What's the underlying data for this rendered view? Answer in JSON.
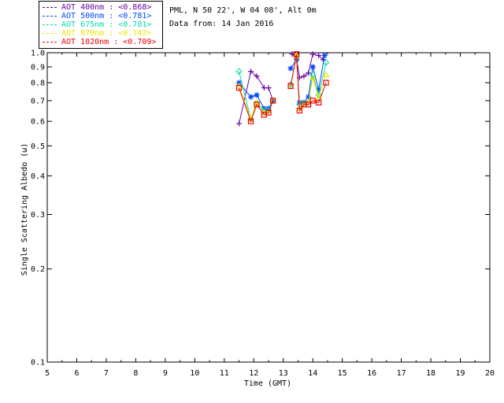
{
  "header": {
    "site_line": "PML, N 50 22', W 04 08', Alt 0m",
    "date_line": "Data from: 14 Jan 2016"
  },
  "legend": [
    {
      "label": "AOT  400nm : <0.868>",
      "color": "#6a00a8"
    },
    {
      "label": "AOT  500nm : <0.781>",
      "color": "#0044ff"
    },
    {
      "label": "AOT  675nm : <0.781>",
      "color": "#00d8b0"
    },
    {
      "label": "AOT  870nm : <0.742>",
      "color": "#e8e800"
    },
    {
      "label": "AOT 1020nm : <0.709>",
      "color": "#ee0000"
    }
  ],
  "chart_data": {
    "type": "scatter",
    "xlabel": "Time (GMT)",
    "ylabel": "Single Scattering Albedo (ω)",
    "xlim": [
      5,
      20
    ],
    "ylim": [
      0.1,
      1.0
    ],
    "yscale": "log",
    "xticks": [
      5,
      6,
      7,
      8,
      9,
      10,
      11,
      12,
      13,
      14,
      15,
      16,
      17,
      18,
      19,
      20
    ],
    "yticks": [
      0.1,
      0.2,
      0.3,
      0.4,
      0.5,
      0.6,
      0.7,
      0.8,
      0.9,
      1.0
    ],
    "ytick_labels": [
      "0.1",
      "0.2",
      "0.3",
      "0.4",
      "0.5",
      "0.6",
      "0.7",
      "0.8",
      "0.9",
      "1.0"
    ],
    "grid": false,
    "series": [
      {
        "name": "AOT  400nm",
        "color": "#6a00a8",
        "marker": "plus",
        "x": [
          11.5,
          11.9,
          12.1,
          12.35,
          12.5,
          12.65,
          13.3,
          13.45,
          13.55,
          13.7,
          13.85,
          14.0,
          14.2,
          14.35
        ],
        "y": [
          0.59,
          0.87,
          0.84,
          0.77,
          0.77,
          0.7,
          0.99,
          0.96,
          0.83,
          0.84,
          0.86,
          0.99,
          0.98,
          0.95
        ]
      },
      {
        "name": "AOT  500nm",
        "color": "#0044ff",
        "marker": "star",
        "x": [
          11.5,
          11.9,
          12.1,
          12.35,
          12.5,
          12.65,
          13.25,
          13.45,
          13.55,
          13.7,
          13.85,
          14.0,
          14.2,
          14.4
        ],
        "y": [
          0.8,
          0.72,
          0.73,
          0.66,
          0.66,
          0.7,
          0.89,
          0.95,
          0.69,
          0.69,
          0.72,
          0.9,
          0.76,
          0.98
        ]
      },
      {
        "name": "AOT  675nm",
        "color": "#00d8b0",
        "marker": "diamond",
        "x": [
          11.5,
          11.9,
          12.1,
          12.35,
          12.5,
          12.65,
          13.25,
          13.45,
          13.55,
          13.7,
          13.85,
          14.0,
          14.2,
          14.45
        ],
        "y": [
          0.87,
          0.61,
          0.69,
          0.65,
          0.65,
          0.7,
          0.79,
          0.97,
          0.68,
          0.69,
          0.69,
          0.85,
          0.73,
          0.93
        ]
      },
      {
        "name": "AOT  870nm",
        "color": "#e8e800",
        "marker": "triangle",
        "x": [
          11.5,
          11.9,
          12.1,
          12.35,
          12.5,
          12.65,
          13.25,
          13.45,
          13.55,
          13.7,
          13.85,
          14.0,
          14.2,
          14.45
        ],
        "y": [
          0.78,
          0.61,
          0.69,
          0.64,
          0.64,
          0.7,
          0.78,
          0.98,
          0.66,
          0.68,
          0.69,
          0.83,
          0.72,
          0.85
        ]
      },
      {
        "name": "AOT 1020nm",
        "color": "#ee0000",
        "marker": "square",
        "x": [
          11.5,
          11.9,
          12.1,
          12.35,
          12.5,
          12.65,
          13.25,
          13.45,
          13.55,
          13.7,
          13.85,
          14.0,
          14.2,
          14.45
        ],
        "y": [
          0.77,
          0.6,
          0.68,
          0.63,
          0.64,
          0.7,
          0.78,
          0.99,
          0.65,
          0.68,
          0.68,
          0.7,
          0.69,
          0.8
        ]
      }
    ]
  }
}
